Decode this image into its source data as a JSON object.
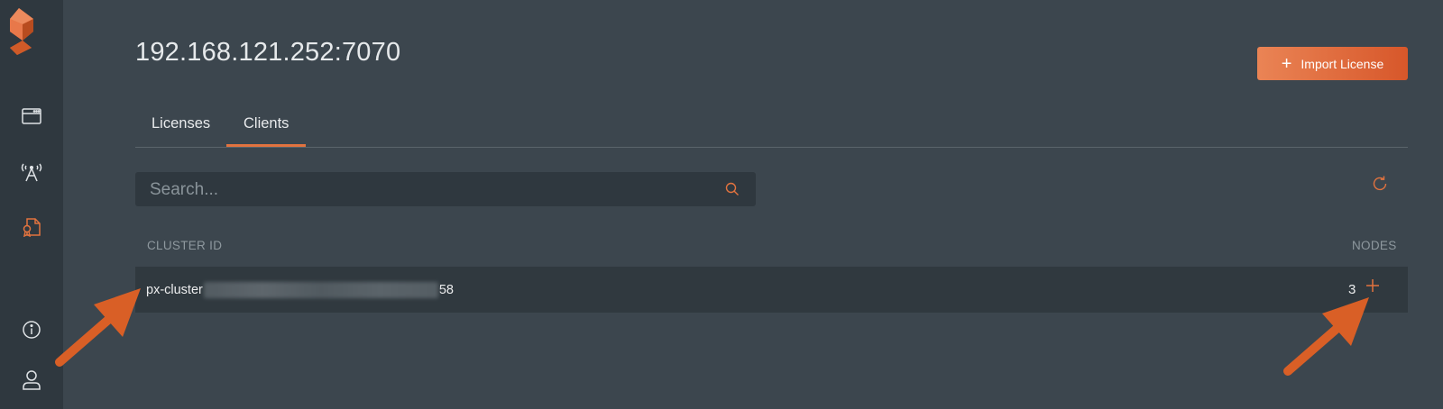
{
  "sidebar": {
    "logo": "portworx-logo",
    "items": [
      {
        "name": "browser-window-icon",
        "active": false
      },
      {
        "name": "antenna-icon",
        "active": false
      },
      {
        "name": "license-document-icon",
        "active": true
      },
      {
        "name": "info-icon",
        "active": false
      },
      {
        "name": "user-icon",
        "active": false
      }
    ]
  },
  "header": {
    "title": "192.168.121.252:7070",
    "import_button": {
      "label": "Import License",
      "icon": "plus-icon"
    }
  },
  "tabs": [
    {
      "label": "Licenses",
      "active": false
    },
    {
      "label": "Clients",
      "active": true
    }
  ],
  "search": {
    "placeholder": "Search...",
    "value": ""
  },
  "table": {
    "columns": [
      "CLUSTER ID",
      "NODES"
    ],
    "rows": [
      {
        "cluster_prefix": "px-cluster",
        "cluster_suffix": "58",
        "nodes": "3"
      }
    ]
  },
  "colors": {
    "accent": "#e2733f",
    "background": "#3c464e",
    "sidebar": "#2f383f",
    "annotation_arrow": "#d95f26"
  }
}
